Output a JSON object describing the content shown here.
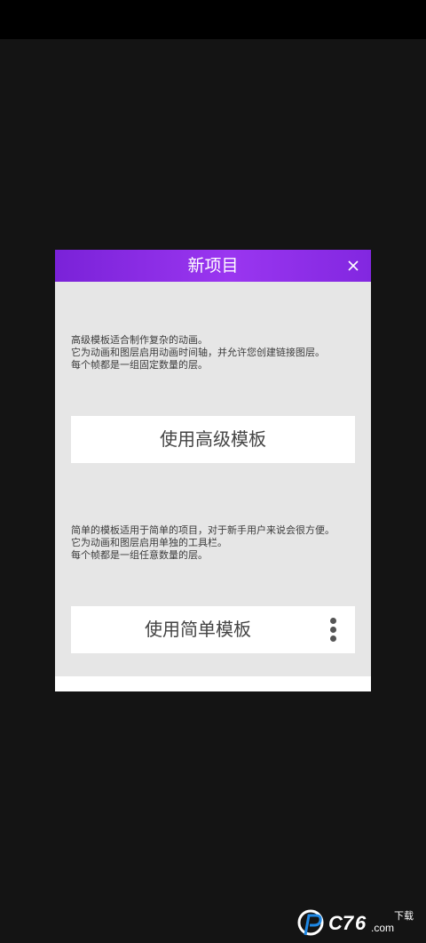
{
  "dialog": {
    "title": "新项目",
    "close_icon": "close-icon",
    "advanced": {
      "description_lines": [
        "高级模板适合制作复杂的动画。",
        "它为动画和图层启用动画时间轴，并允许您创建链接图层。",
        "每个帧都是一组固定数量的层。"
      ],
      "button_label": "使用高级模板"
    },
    "simple": {
      "description_lines": [
        "简单的模板适用于简单的项目，对于新手用户来说会很方便。",
        "它为动画和图层启用单独的工具栏。",
        "每个帧都是一组任意数量的层。"
      ],
      "button_label": "使用简单模板",
      "more_icon": "more-vertical-icon"
    }
  },
  "colors": {
    "header_gradient_start": "#7a22d8",
    "header_gradient_mid": "#9a36f0",
    "dialog_body": "#e6e6e6",
    "page_background": "#141414"
  },
  "watermark": {
    "logo_icon": "pc-site-logo",
    "text": "PC 7 6.com"
  }
}
